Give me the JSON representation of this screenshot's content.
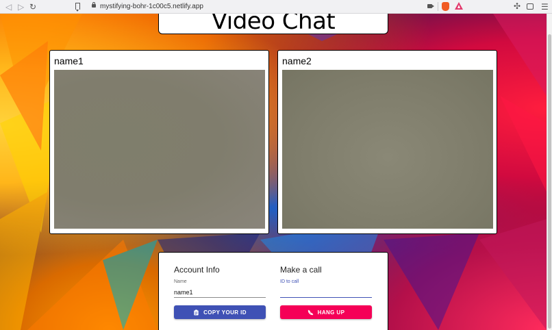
{
  "browser": {
    "url": "mystifying-bohr-1c00c5.netlify.app",
    "icons": [
      "back-icon",
      "forward-icon",
      "reload-icon",
      "bookmark-icon",
      "lock-icon",
      "camera-icon",
      "brave-shield-icon",
      "brave-rewards-icon",
      "extensions-icon",
      "wallet-icon",
      "menu-icon"
    ]
  },
  "page": {
    "title": "Video Chat"
  },
  "videos": [
    {
      "name": "name1"
    },
    {
      "name": "name2"
    }
  ],
  "account": {
    "heading": "Account Info",
    "name_label": "Name",
    "name_value": "name1",
    "copy_button": "COPY YOUR ID"
  },
  "call": {
    "heading": "Make a call",
    "id_label": "ID to call",
    "id_value": "",
    "hangup_button": "HANG UP"
  },
  "colors": {
    "primary": "#3f51b5",
    "secondary": "#f50057"
  }
}
